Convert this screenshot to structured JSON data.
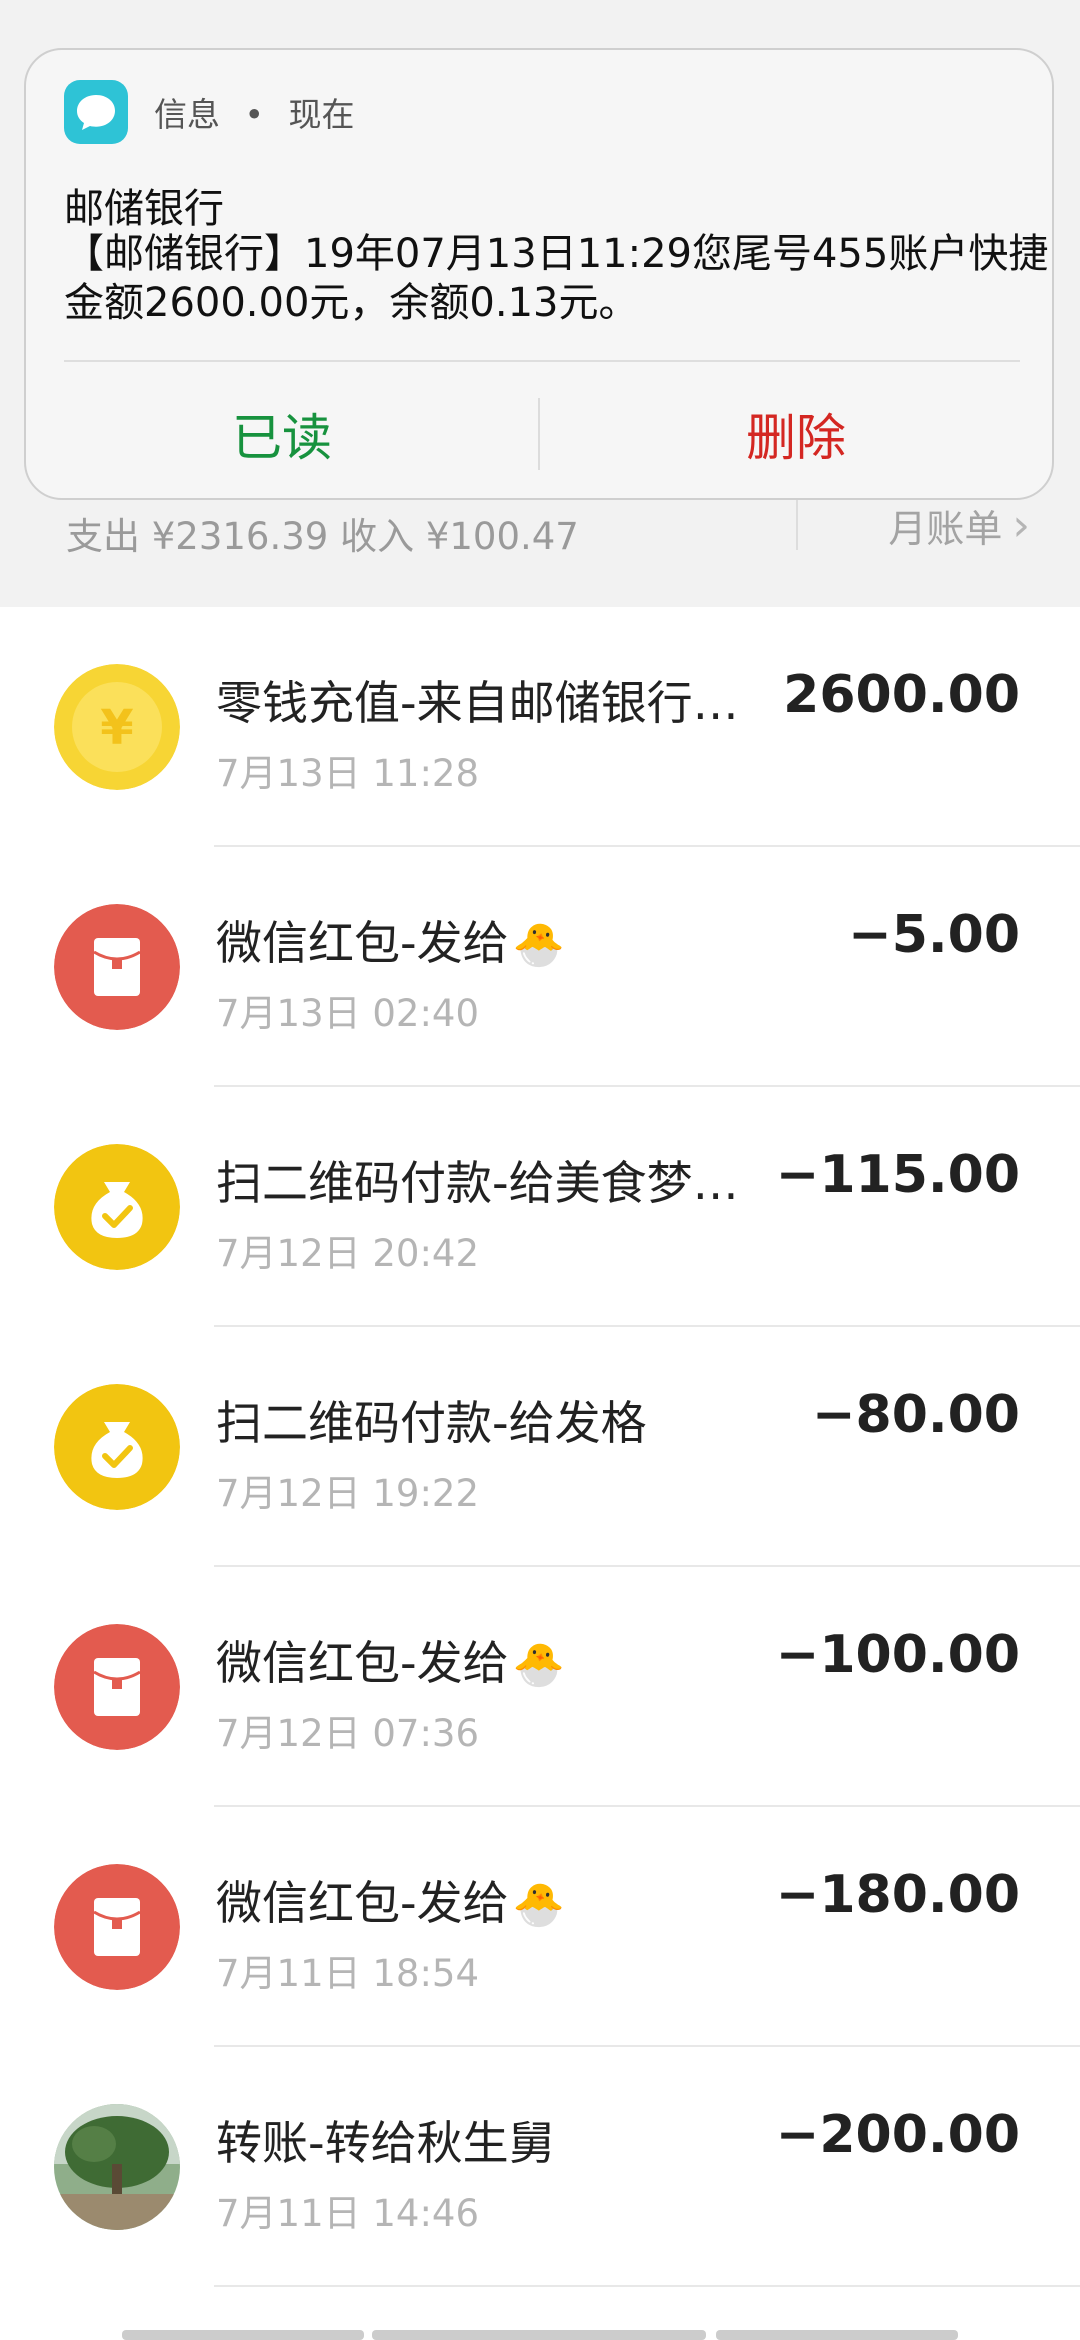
{
  "notification": {
    "app_name": "信息",
    "separator": "•",
    "time": "现在",
    "sender": "邮储银行",
    "body": "【邮储银行】19年07月13日11:29您尾号455账户快捷金额2600.00元，余额0.13元。",
    "read_label": "已读",
    "delete_label": "删除",
    "icon": "message-bubble-icon"
  },
  "summary": {
    "text": "支出 ¥2316.39 收入 ¥100.47",
    "monthly_label": "月账单"
  },
  "transactions": [
    {
      "title": "零钱充值-来自邮储银行…",
      "time": "7月13日 11:28",
      "amount": "2600.00",
      "icon": "yuan-coin-icon"
    },
    {
      "title": "微信红包-发给",
      "emoji": "🐣",
      "time": "7月13日 02:40",
      "amount": "−5.00",
      "icon": "red-packet-icon"
    },
    {
      "title": "扫二维码付款-给美食梦…",
      "time": "7月12日 20:42",
      "amount": "−115.00",
      "icon": "money-bag-icon"
    },
    {
      "title": "扫二维码付款-给发格",
      "time": "7月12日 19:22",
      "amount": "−80.00",
      "icon": "money-bag-icon"
    },
    {
      "title": "微信红包-发给",
      "emoji": "🐣",
      "time": "7月12日 07:36",
      "amount": "−100.00",
      "icon": "red-packet-icon"
    },
    {
      "title": "微信红包-发给",
      "emoji": "🐣",
      "time": "7月11日 18:54",
      "amount": "−180.00",
      "icon": "red-packet-icon"
    },
    {
      "title": "转账-转给秋生舅",
      "time": "7月11日 14:46",
      "amount": "−200.00",
      "icon": "avatar-photo-icon"
    }
  ],
  "colors": {
    "read": "#17923e",
    "delete": "#d42722",
    "coin": "#f7d534",
    "bag": "#f2c511",
    "red_packet": "#e35b4f"
  }
}
